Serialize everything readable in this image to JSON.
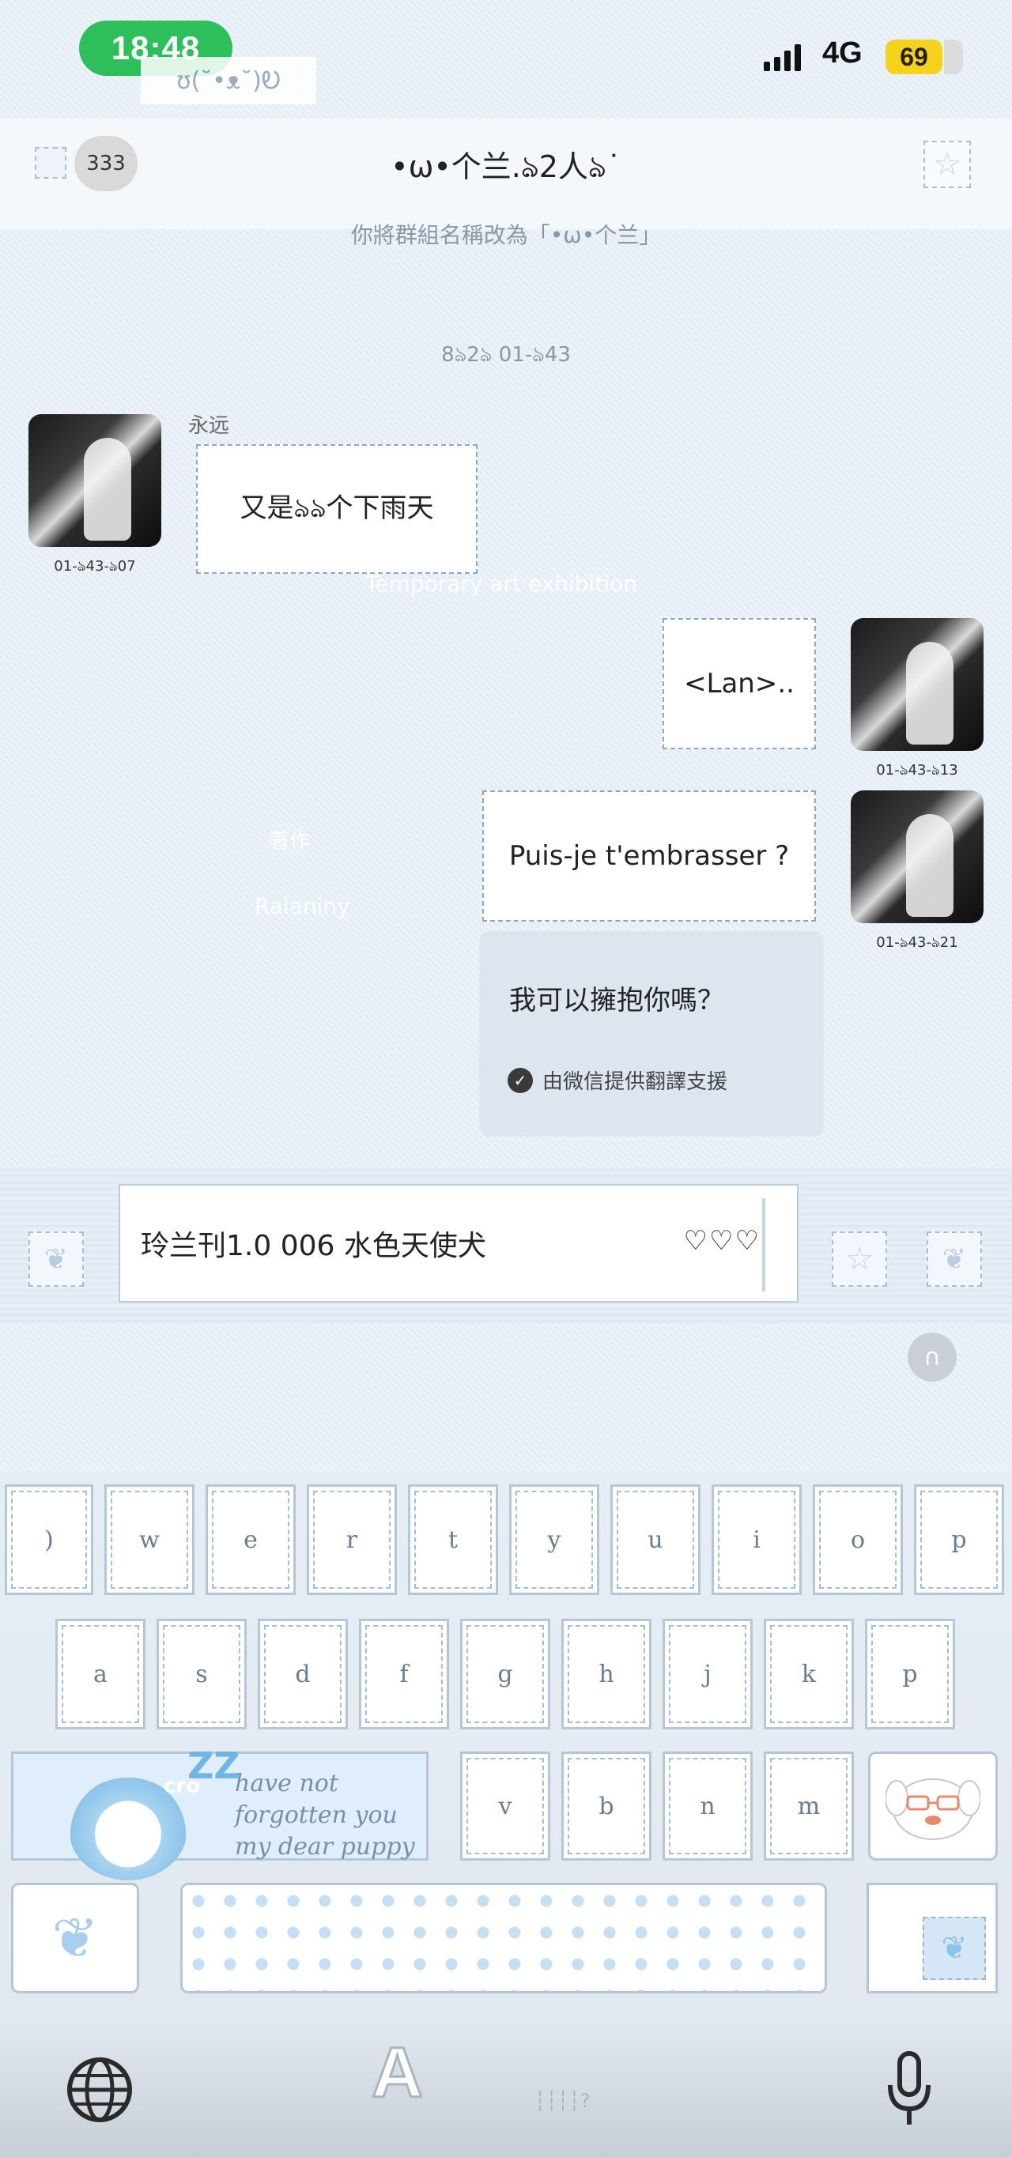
{
  "status_bar": {
    "time": "18:48",
    "kaomoji": "ʊ(˘•ᴥ˘)Ꭷ",
    "network": "4G",
    "battery": "69",
    "signal_icon": "signal-bars-icon"
  },
  "header": {
    "unread_count": "333",
    "title": "•ω•个兰.ঌ2人ঌ˙",
    "back_icon": "back-icon",
    "star_icon": "star-icon"
  },
  "system_message": "你將群組名稱改為「•ω•个兰」",
  "timestamp": "8ঌ2ঌ 01-ঌ43",
  "messages": [
    {
      "side": "left",
      "sender": "永远",
      "text": "又是ঌঌ个下雨天",
      "time": "01-ঌ43-ঌ07"
    },
    {
      "side": "right",
      "text": "<Lan>..",
      "time": "01-ঌ43-ঌ13"
    },
    {
      "side": "right",
      "text": "Puis-je t'embrasser ?",
      "time": "01-ঌ43-ঌ21",
      "translation": "我可以擁抱你嗎？",
      "translation_note": "由微信提供翻譯支援"
    }
  ],
  "watermarks": {
    "exhibition": "Temporary art exhibition",
    "author": "著作",
    "brand": "Ralaniny"
  },
  "input_bar": {
    "value": "玲兰刊1.0 006 水色天使犬",
    "hearts": "♡♡♡"
  },
  "keyboard": {
    "row1": [
      ")",
      "w",
      "e",
      "r",
      "t",
      "y",
      "u",
      "i",
      "o",
      "p"
    ],
    "row2": [
      "a",
      "s",
      "d",
      "f",
      "g",
      "h",
      "j",
      "k",
      "p"
    ],
    "row3": [
      "v",
      "b",
      "n",
      "m"
    ],
    "sticker_text_lines": [
      "have not",
      "forgotten you",
      "my dear puppy"
    ],
    "sticker_tag": "cro",
    "zz": "ZZ",
    "shift_letter": "A"
  }
}
